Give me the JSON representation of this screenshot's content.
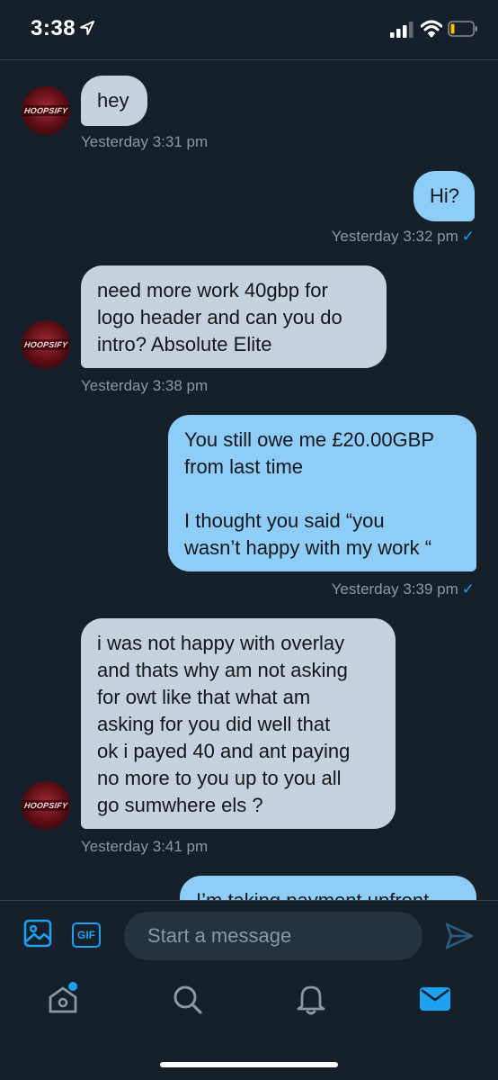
{
  "status_bar": {
    "time": "3:38"
  },
  "messages": [
    {
      "dir": "in",
      "text": "hey",
      "time": "Yesterday 3:31 pm"
    },
    {
      "dir": "out",
      "text": "Hi?",
      "time": "Yesterday 3:32 pm"
    },
    {
      "dir": "in",
      "text": "need more work 40gbp for\nlogo header and can you do\nintro? Absolute Elite",
      "time": "Yesterday 3:38 pm"
    },
    {
      "dir": "out",
      "text": "You still owe me £20.00GBP\nfrom last time\n\nI thought you said “you\nwasn’t happy with my work “",
      "time": "Yesterday 3:39 pm"
    },
    {
      "dir": "in",
      "text": "i was not happy with overlay\nand thats why am not asking\nfor owt like that what am\nasking for you did well that\nok i payed 40 and ant paying\nno more to you up to you all\ngo sumwhere els ?",
      "time": "Yesterday 3:41 pm"
    },
    {
      "dir": "out",
      "text": "I’m taking payment upfront",
      "time": ""
    }
  ],
  "avatar_label": "HOOPSIFY",
  "read_mark": "✓",
  "composer": {
    "gif_label": "GIF",
    "placeholder": "Start a message"
  },
  "tabs": [
    "home-icon",
    "search-icon",
    "notifications-icon",
    "messages-icon"
  ],
  "colors": {
    "accent": "#1da1f2",
    "background": "#15202b",
    "incoming_bubble": "#c5d1dc",
    "outgoing_bubble": "#8ecdf8",
    "muted_text": "#8899a6"
  }
}
